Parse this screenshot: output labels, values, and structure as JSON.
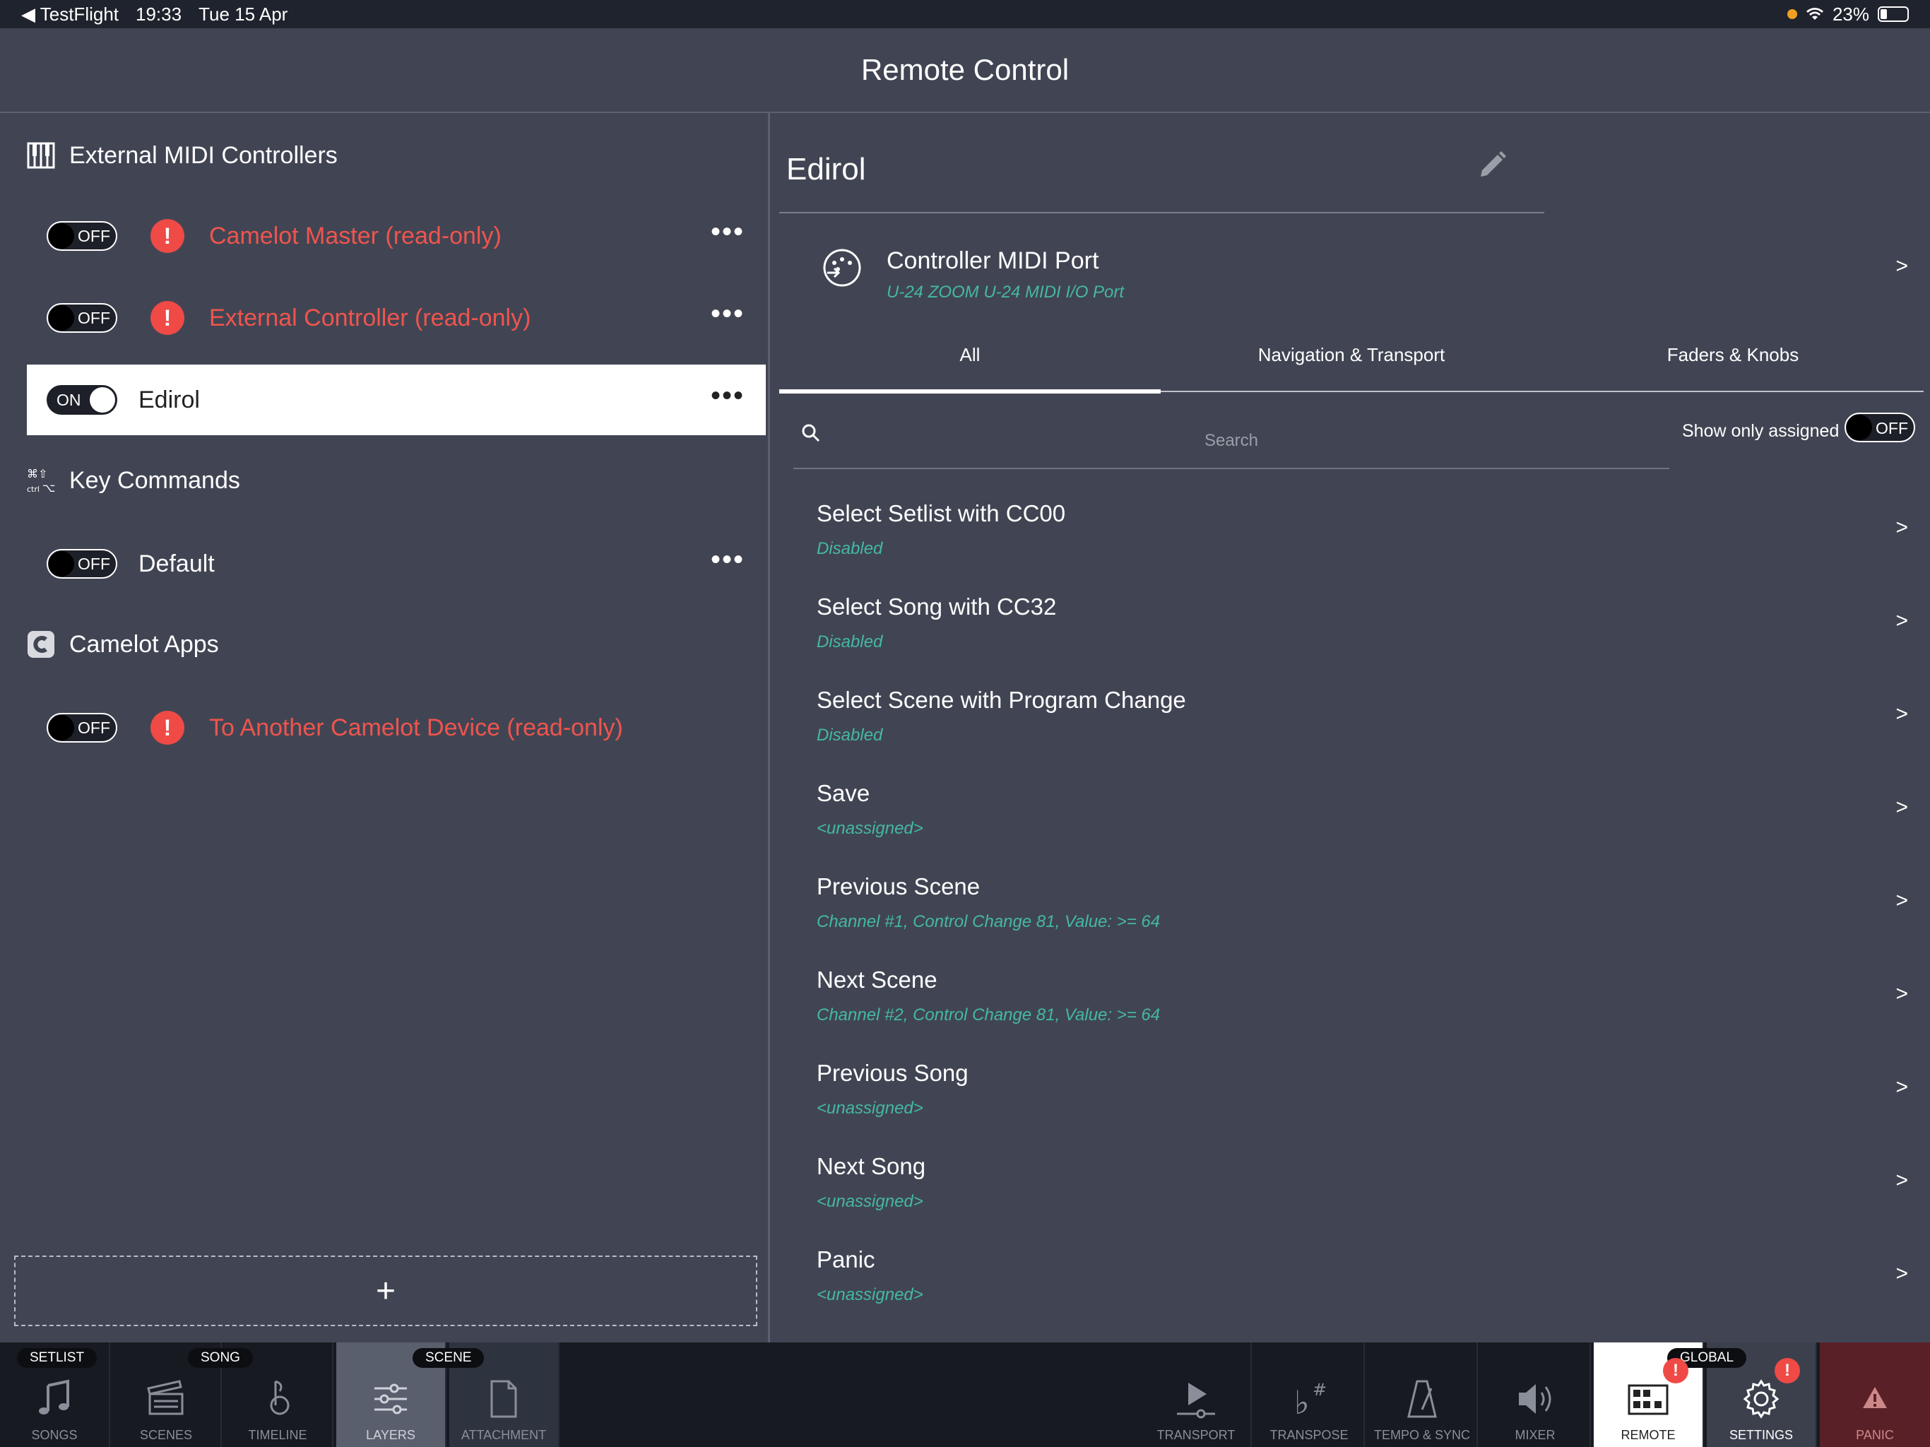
{
  "status": {
    "app": "TestFlight",
    "time": "19:33",
    "date": "Tue 15 Apr",
    "battery": "23%"
  },
  "header": {
    "title": "Remote Control"
  },
  "left": {
    "sections": [
      {
        "title": "External MIDI Controllers",
        "icon": "piano-keys-icon"
      },
      {
        "title": "Key Commands",
        "icon": "keyboard-keys-icon"
      },
      {
        "title": "Camelot Apps",
        "icon": "camelot-c-icon"
      }
    ],
    "rows": [
      {
        "toggle": "OFF",
        "label": "Camelot Master (read-only)"
      },
      {
        "toggle": "OFF",
        "label": "External Controller (read-only)"
      },
      {
        "toggle": "ON",
        "label": "Edirol"
      },
      {
        "toggle": "OFF",
        "label": "Default"
      },
      {
        "toggle": "OFF",
        "label": "To Another Camelot Device (read-only)"
      }
    ],
    "add_label": "+"
  },
  "right": {
    "device_name": "Edirol",
    "port": {
      "title": "Controller MIDI Port",
      "value": "U-24 ZOOM U-24 MIDI I/O Port"
    },
    "chevron": ">",
    "tabs": [
      "All",
      "Navigation & Transport",
      "Faders & Knobs"
    ],
    "active_tab": "All",
    "search_placeholder": "Search",
    "show_only_assigned": {
      "label": "Show only assigned",
      "state": "OFF"
    },
    "items": [
      {
        "title": "Select Setlist with CC00",
        "sub": "Disabled"
      },
      {
        "title": "Select Song with CC32",
        "sub": "Disabled"
      },
      {
        "title": "Select Scene with Program Change",
        "sub": "Disabled"
      },
      {
        "title": "Save",
        "sub": "<unassigned>"
      },
      {
        "title": "Previous Scene",
        "sub": "Channel #1, Control Change 81, Value: >= 64"
      },
      {
        "title": "Next Scene",
        "sub": "Channel #2, Control Change 81, Value: >= 64"
      },
      {
        "title": "Previous Song",
        "sub": "<unassigned>"
      },
      {
        "title": "Next Song",
        "sub": "<unassigned>"
      },
      {
        "title": "Panic",
        "sub": "<unassigned>"
      }
    ]
  },
  "bottombar": {
    "groups": {
      "setlist": "SETLIST",
      "song": "SONG",
      "scene": "SCENE",
      "global": "GLOBAL"
    },
    "tabs": [
      {
        "label": "SONGS",
        "icon": "music-note-icon"
      },
      {
        "label": "SCENES",
        "icon": "clapperboard-icon"
      },
      {
        "label": "TIMELINE",
        "icon": "timeline-icon"
      },
      {
        "label": "LAYERS",
        "icon": "sliders-icon"
      },
      {
        "label": "ATTACHMENT",
        "icon": "document-icon"
      },
      {
        "label": "TRANSPORT",
        "icon": "play-icon"
      },
      {
        "label": "TRANSPOSE",
        "icon": "flat-sharp-icon"
      },
      {
        "label": "TEMPO & SYNC",
        "icon": "metronome-icon"
      },
      {
        "label": "MIXER",
        "icon": "speaker-icon"
      },
      {
        "label": "REMOTE",
        "icon": "remote-grid-icon"
      },
      {
        "label": "SETTINGS",
        "icon": "gear-icon"
      },
      {
        "label": "PANIC",
        "icon": "warning-icon"
      }
    ],
    "badge": "!"
  },
  "colors": {
    "background": "#414553",
    "alert": "#ef4a46",
    "subtext": "#44b8a4",
    "bar": "#171a21"
  }
}
